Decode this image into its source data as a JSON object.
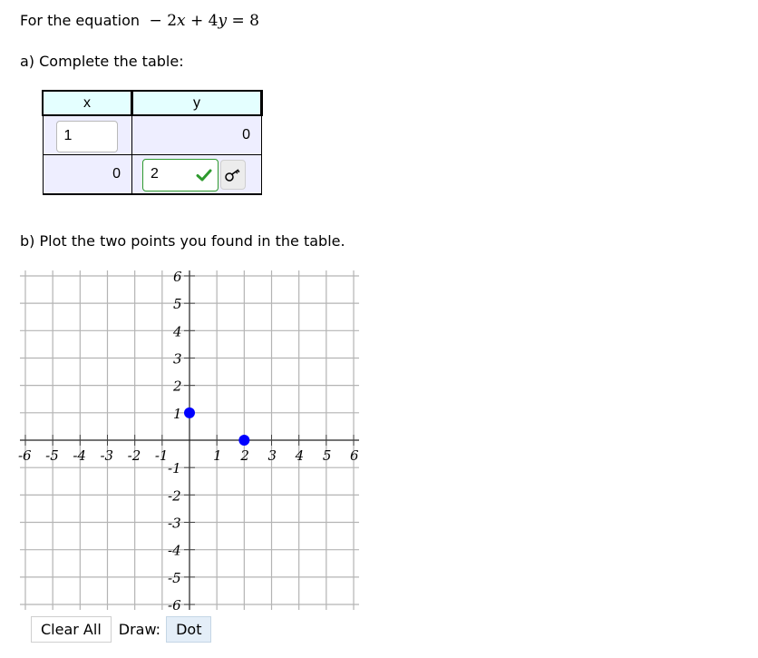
{
  "prompt": {
    "lead": "For the equation",
    "equation": {
      "minus": "−",
      "c1": "2",
      "v1": "x",
      "plus": "+",
      "c2": "4",
      "v2": "y",
      "eq": "=",
      "rhs": "8"
    }
  },
  "part_a": {
    "label": "a) Complete the table:"
  },
  "table": {
    "headers": {
      "x": "x",
      "y": "y"
    },
    "rows": [
      {
        "x": {
          "type": "input",
          "value": "1",
          "state": "empty-check"
        },
        "y": {
          "type": "static",
          "value": "0"
        }
      },
      {
        "x": {
          "type": "static",
          "value": "0"
        },
        "y": {
          "type": "input",
          "value": "2",
          "state": "correct"
        }
      }
    ],
    "icons": {
      "correct": "check-icon",
      "key": "key-icon"
    },
    "colors": {
      "header_bg": "#e4ffff",
      "cell_bg": "#eeeeff",
      "correct": "#2e9a2e"
    }
  },
  "part_b": {
    "label": "b) Plot the two points you found in the table."
  },
  "graph": {
    "x_range": [
      -6,
      6
    ],
    "y_range": [
      -6,
      6
    ],
    "x_tick_labels": [
      "-6",
      "-5",
      "-4",
      "-3",
      "-2",
      "-1",
      "1",
      "2",
      "3",
      "4",
      "5",
      "6"
    ],
    "y_tick_labels": [
      "6",
      "5",
      "4",
      "3",
      "2",
      "1",
      "-1",
      "-2",
      "-3",
      "-4",
      "-5",
      "-6"
    ],
    "points": [
      {
        "x": 0,
        "y": 1
      },
      {
        "x": 2,
        "y": 0
      }
    ],
    "point_color": "#0000ff"
  },
  "controls": {
    "clear_all": "Clear All",
    "draw_label": "Draw:",
    "dot": "Dot"
  }
}
